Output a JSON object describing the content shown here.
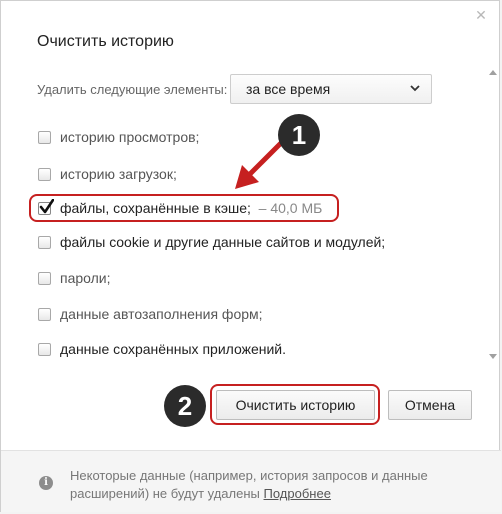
{
  "dialog": {
    "title": "Очистить историю",
    "close_icon": "close-icon"
  },
  "range": {
    "label": "Удалить следующие элементы:",
    "selected": "за все время"
  },
  "items": [
    {
      "label": "историю просмотров;",
      "checked": false
    },
    {
      "label": "историю загрузок;",
      "checked": false
    },
    {
      "label": "файлы, сохранённые в кэше;",
      "size": "–  40,0 МБ",
      "checked": true
    },
    {
      "label": "файлы cookie и другие данные сайтов и модулей;",
      "checked": false
    },
    {
      "label": "пароли;",
      "checked": false
    },
    {
      "label": "данные автозаполнения форм;",
      "checked": false
    },
    {
      "label": "данные сохранённых приложений.",
      "checked": false
    }
  ],
  "annotations": {
    "badge1": "1",
    "badge2": "2",
    "accent_color": "#c62020"
  },
  "buttons": {
    "clear": "Очистить историю",
    "cancel": "Отмена"
  },
  "footer": {
    "text": "Некоторые данные (например, история запросов и данные расширений) не будут удалены",
    "link": "Подробнее",
    "icon": "info-icon"
  }
}
